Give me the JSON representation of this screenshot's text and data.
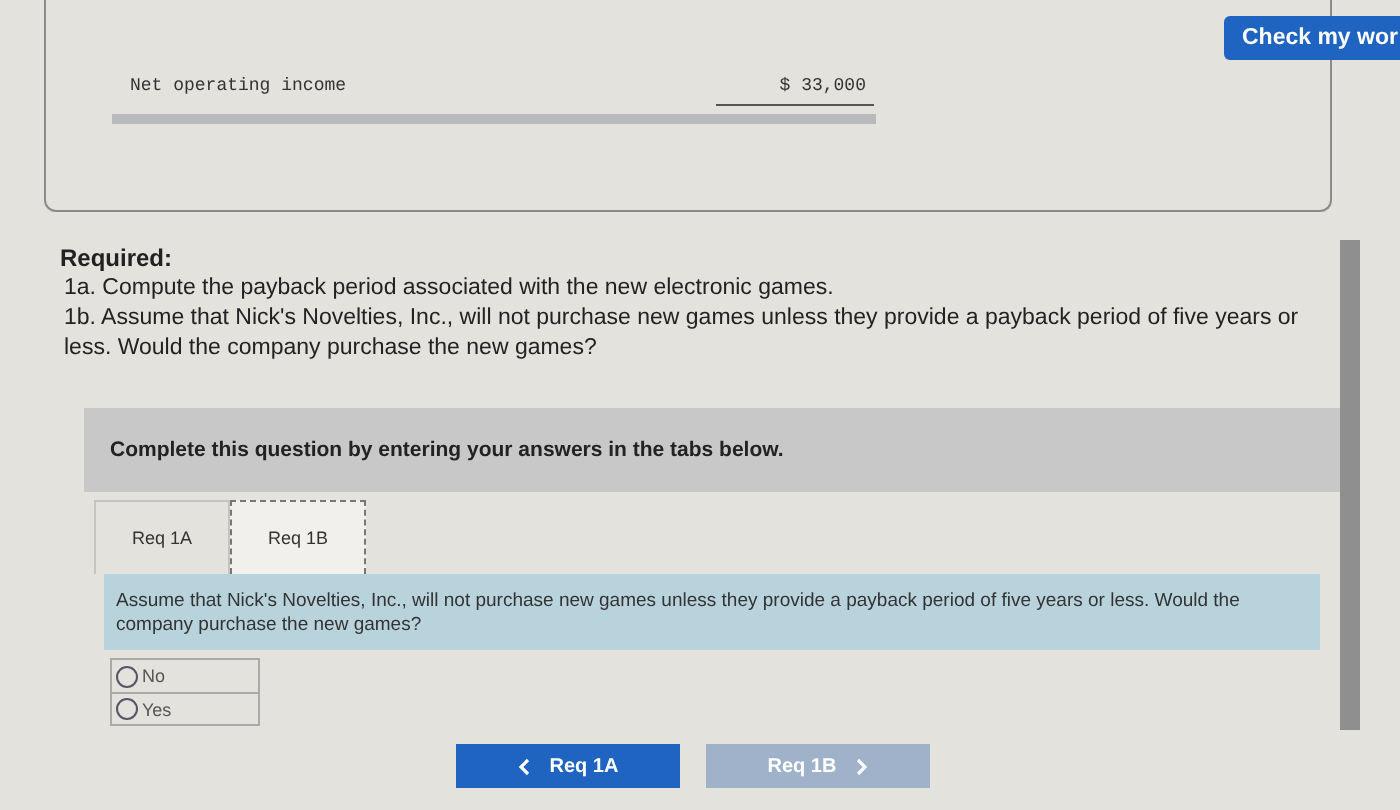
{
  "check_button": {
    "label": "Check my wor"
  },
  "statement": {
    "label": "Net operating income",
    "value": "$ 33,000"
  },
  "required": {
    "heading": "Required:",
    "items": [
      "1a. Compute the payback period associated with the new electronic games.",
      "1b. Assume that Nick's Novelties, Inc., will not purchase new games unless they provide a payback period of five years or less. Would the company purchase the new games?"
    ]
  },
  "instructions": "Complete this question by entering your answers in the tabs below.",
  "tabs": [
    {
      "label": "Req 1A",
      "selected": false
    },
    {
      "label": "Req 1B",
      "selected": true
    }
  ],
  "question": "Assume that Nick's Novelties, Inc., will not purchase new games unless they provide a payback period of five years or less. Would the company purchase the new games?",
  "options": [
    {
      "label": "No",
      "selected": false
    },
    {
      "label": "Yes",
      "selected": false
    }
  ],
  "nav": [
    {
      "label": "Req 1A",
      "kind": "prev",
      "disabled": false
    },
    {
      "label": "Req 1B",
      "kind": "next",
      "disabled": true
    }
  ]
}
